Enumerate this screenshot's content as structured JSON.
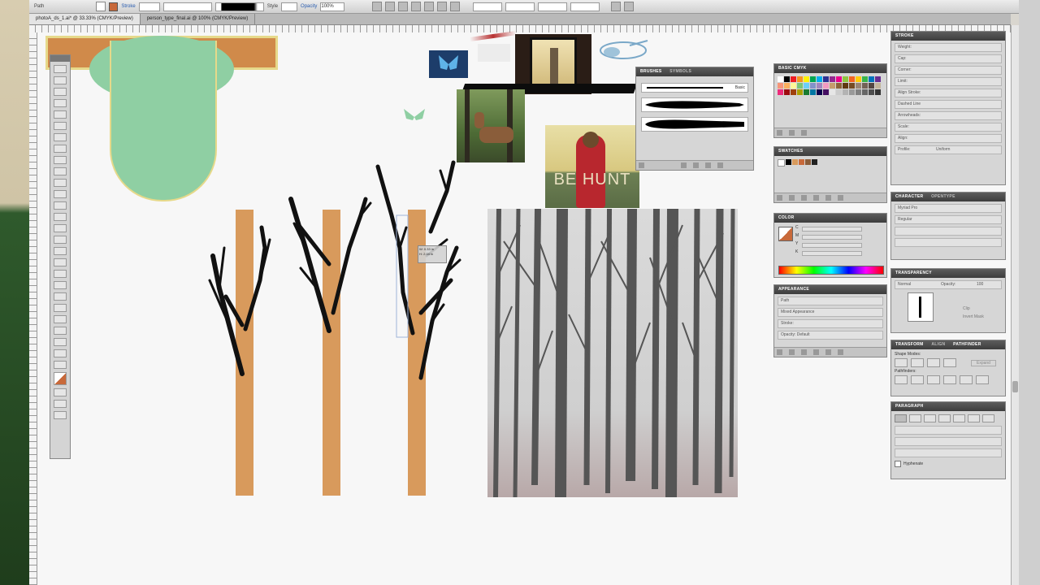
{
  "app": {
    "control_bar": {
      "mode_label": "Path",
      "stroke_label": "Stroke",
      "style_label": "Style",
      "opacity_label": "Opacity",
      "opacity_value": "100%",
      "fill_color": "#ffffff",
      "stroke_color": "#c8693a"
    },
    "tabs": [
      {
        "label": "photoA_ds_1.ai* @ 33.33% (CMYK/Preview)",
        "active": true
      },
      {
        "label": "person_type_final.ai @ 100% (CMYK/Preview)",
        "active": false
      }
    ],
    "canvas": {
      "bg": "#f7f7f7",
      "artwork": {
        "header_band_color": "#d08a4a",
        "header_border_color": "#e6d98a",
        "green_shape_color": "#8fcfa3",
        "trunk_color": "#d89a5c",
        "branch_color": "#111111",
        "trunk_count": 3
      },
      "photos": [
        {
          "name": "blue-butterfly"
        },
        {
          "name": "woman-in-frame"
        },
        {
          "name": "bird-sketch"
        },
        {
          "name": "deer-in-forest"
        },
        {
          "name": "bear-poster",
          "caption": "BE HUNT"
        },
        {
          "name": "forest-sketch"
        }
      ],
      "selection_tooltip": "W: 0.33 in\nH: 2.04 in"
    },
    "panels": {
      "brushes": {
        "tabs": [
          "BRUSHES",
          "SYMBOLS"
        ],
        "basic_label": "Basic"
      },
      "swatches_top": {
        "title": "BASIC CMYK"
      },
      "swatches": {
        "title": "SWATCHES"
      },
      "color": {
        "title": "COLOR",
        "channels": [
          "C",
          "M",
          "Y",
          "K"
        ]
      },
      "appearance": {
        "title": "APPEARANCE",
        "rows": [
          "Path",
          "Mixed Appearance",
          "Stroke:",
          "Opacity: Default"
        ]
      },
      "stroke": {
        "title": "STROKE",
        "rows": [
          "Weight:",
          "Cap:",
          "Corner:",
          "Limit:",
          "Align Stroke:",
          "Dashed Line",
          "Arrowheads:",
          "Scale:",
          "Align:",
          "Profile:"
        ],
        "profile_value": "Uniform"
      },
      "character": {
        "tabs": [
          "CHARACTER",
          "OPENTYPE"
        ],
        "font": "Myriad Pro",
        "style": "Regular"
      },
      "transparency": {
        "title": "TRANSPARENCY",
        "blend_mode": "Normal",
        "opacity_label": "Opacity:",
        "opacity_value": "100",
        "clip_label": "Clip",
        "invert_label": "Invert Mask"
      },
      "pathfinder": {
        "tabs": [
          "TRANSFORM",
          "ALIGN",
          "PATHFINDER"
        ],
        "shape_modes_label": "Shape Modes:",
        "expand_label": "Expand",
        "pathfinders_label": "Pathfinders:"
      },
      "paragraph": {
        "title": "PARAGRAPH",
        "hyphenate_label": "Hyphenate"
      }
    },
    "swatch_colors": [
      "#ffffff",
      "#000000",
      "#ed1c24",
      "#f7941d",
      "#fff200",
      "#00a651",
      "#00aeef",
      "#2e3192",
      "#92278f",
      "#ec008c",
      "#8dc63f",
      "#f26522",
      "#ffcb05",
      "#39b54a",
      "#0072bc",
      "#662d91",
      "#f69679",
      "#fbaf5d",
      "#fff799",
      "#7cc576",
      "#6dcff6",
      "#8393ca",
      "#a187be",
      "#f49ac1",
      "#c69c6d",
      "#8c6239",
      "#603913",
      "#754c24",
      "#998675",
      "#736357",
      "#534741",
      "#c2b59b",
      "#ee2a7b",
      "#9e0b0f",
      "#a0410d",
      "#aba000",
      "#197b30",
      "#0076a3",
      "#0d004c",
      "#440e62",
      "#e6e6e6",
      "#cccccc",
      "#b3b3b3",
      "#999999",
      "#808080",
      "#666666",
      "#4d4d4d",
      "#333333"
    ]
  }
}
